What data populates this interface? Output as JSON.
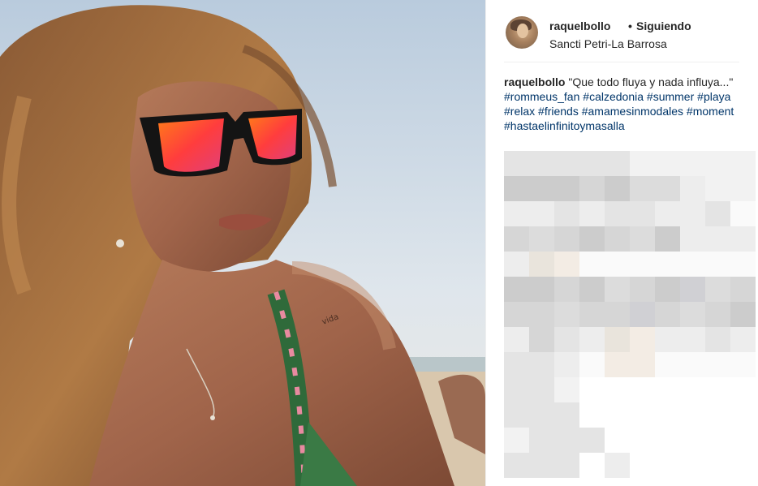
{
  "post": {
    "photo_alt": "Selfie on the beach with reflective sunglasses",
    "username": "raquelbollo",
    "separator": "•",
    "follow_state": "Siguiendo",
    "location": "Sancti Petri-La Barrosa",
    "caption": {
      "user": "raquelbollo",
      "text_line1": "\"Que todo fluya y nada",
      "text_line2": "influya...\"",
      "tags": [
        "#rommeus_fan",
        "#calzedonia",
        "#summer",
        "#playa",
        "#relax",
        "#friends",
        "#amamesinmodales",
        "#moment",
        "#hastaelinfinitoymasalla"
      ]
    },
    "censored_comments": "blurred comments area"
  },
  "colors": {
    "link": "#003569",
    "text": "#262626",
    "divider": "#efefef"
  },
  "icons": {
    "avatar": "profile-avatar"
  }
}
